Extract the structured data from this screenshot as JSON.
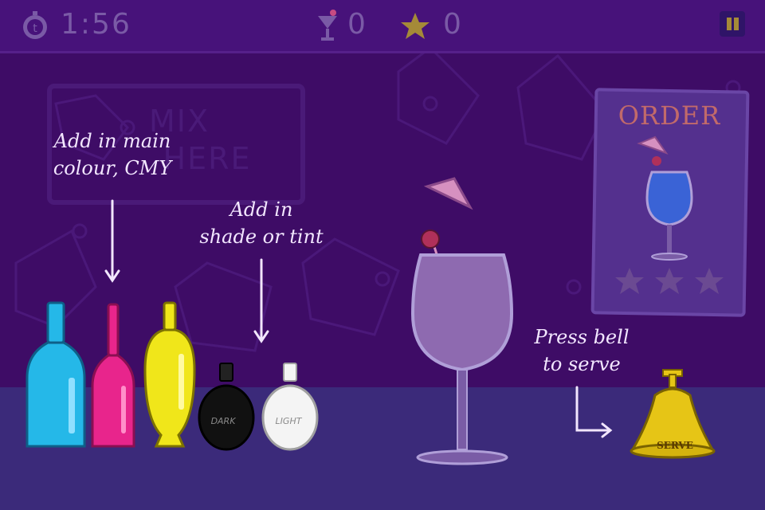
{
  "hud": {
    "timer": "1:56",
    "drinks_served": "0",
    "stars": "0"
  },
  "hints": {
    "main_colour": "Add in main\ncolour, CMY",
    "shade_tint": "Add in\nshade or tint",
    "bell": "Press bell\nto serve"
  },
  "mix_area": {
    "line1": "MIX",
    "line2": "HERE"
  },
  "bottles": [
    {
      "name": "cyan",
      "color": "#25b8e8"
    },
    {
      "name": "magenta",
      "color": "#e8258c"
    },
    {
      "name": "yellow",
      "color": "#f0e61a"
    },
    {
      "name": "dark",
      "label": "DARK",
      "color": "#111111"
    },
    {
      "name": "light",
      "label": "LIGHT",
      "color": "#f4f4f4"
    }
  ],
  "order": {
    "title": "ORDER",
    "drink_color": "#3a63d6",
    "stars_total": 3
  },
  "bell": {
    "label": "SERVE",
    "color": "#e6c516"
  },
  "colors": {
    "background": "#3e0c66",
    "counter": "#3b2a7a",
    "hud_text": "#7a5aa6"
  }
}
